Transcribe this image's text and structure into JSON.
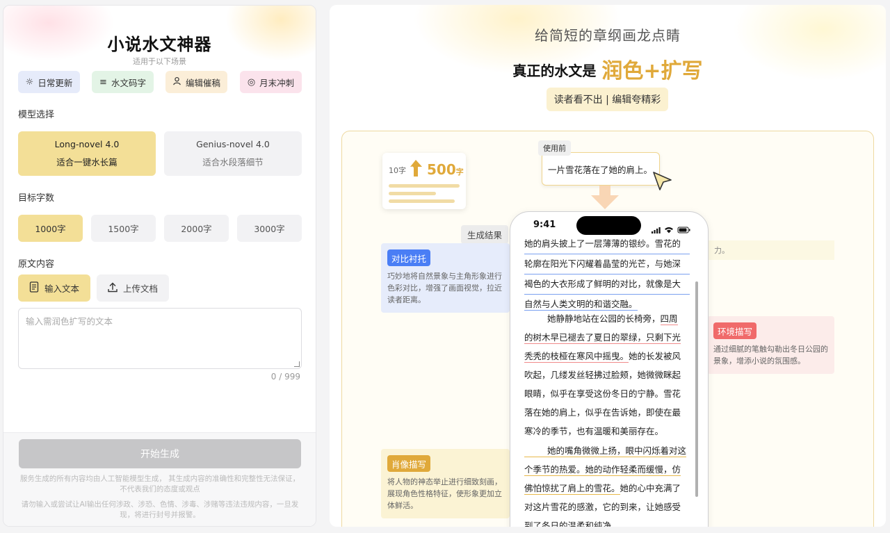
{
  "left": {
    "title": "小说水文神器",
    "subtitle": "适用于以下场景",
    "scenes": [
      {
        "label": "日常更新",
        "icon": "sun-icon",
        "bg": "#e6ebfa"
      },
      {
        "label": "水文码字",
        "icon": "lines-icon",
        "bg": "#e3f4e6"
      },
      {
        "label": "编辑催稿",
        "icon": "user-icon",
        "bg": "#fbeed8"
      },
      {
        "label": "月末冲刺",
        "icon": "target-icon",
        "bg": "#fbe3ec"
      }
    ],
    "model_label": "模型选择",
    "models": [
      {
        "name": "Long-novel 4.0",
        "desc": "适合一键水长篇"
      },
      {
        "name": "Genius-novel 4.0",
        "desc": "适合水段落细节"
      }
    ],
    "count_label": "目标字数",
    "counts": [
      "1000字",
      "1500字",
      "2000字",
      "3000字"
    ],
    "source_label": "原文内容",
    "source_buttons": {
      "input": "输入文本",
      "upload": "上传文档"
    },
    "textarea_placeholder": "输入需润色扩写的文本",
    "char_counter": "0 / 999",
    "generate_label": "开始生成",
    "disclaimer1": "服务生成的所有内容均由人工智能模型生成， 其生成内容的准确性和完整性无法保证， 不代表我们的态度或观点",
    "disclaimer2": "请勿输入或尝试让AI输出任何涉政、涉恐、色情、涉毒、涉赌等违法违规内容，一旦发现，将进行封号并报警。"
  },
  "right": {
    "tagline": "给简短的章纲画龙点睛",
    "headline": "真正的水文是",
    "headline_accent": "润色+扩写",
    "pill": "读者看不出 | 编辑夸精彩",
    "word_count": {
      "from": "10字",
      "to": "500",
      "to_unit": "字"
    },
    "before_tag": "使用前",
    "before_text": "一片雪花落在了她的肩上。",
    "result_tag": "生成结果",
    "tips": {
      "contrast": {
        "title": "对比衬托",
        "desc": "巧妙地将自然景象与主角形象进行色彩对比，增强了画面视觉，拉近读者距离。"
      },
      "environment": {
        "title": "环境描写",
        "desc": "通过细腻的笔触勾勒出冬日公园的景象，增添小说的氛围感。"
      },
      "portrait": {
        "title": "肖像描写",
        "desc": "将人物的神态举止进行细致刻画，展现角色性格特征，使形象更加立体鲜活。"
      },
      "strip_text": "力。"
    },
    "phone": {
      "time": "9:41",
      "p1": [
        "她的肩头披上了一层薄薄的银纱。雪花的",
        "轮廓在阳光下闪耀着晶莹的光芒，与她深",
        "褐色的大衣形成了鲜明的对比，就像是大",
        "自然与人类文明的和谐交融。"
      ],
      "p2": [
        "她静静地站在公园的长椅旁，",
        "四周",
        "的树木早已褪去了夏日的翠绿，只剩下光",
        "秃秃的枝桠在寒风中摇曳。",
        "她的长发被风",
        "吹起，几缕发丝轻拂过脸颊，她微微眯起",
        "眼睛，似乎在享受这份冬日的宁静。雪花",
        "落在她的肩上，似乎在告诉她，即使在最",
        "寒冷的季节，也有温暖和美丽存在。"
      ],
      "p3": [
        "她的嘴角微微上扬，眼中闪烁着对这",
        "个季节的热爱。",
        "她的动作轻柔而缓慢，仿",
        "佛怕惊扰了肩上的雪花。",
        "她的心中充满了",
        "对这片雪花的感激，它的到来，让她感受",
        "到了冬日的温柔和纯净。"
      ]
    }
  }
}
